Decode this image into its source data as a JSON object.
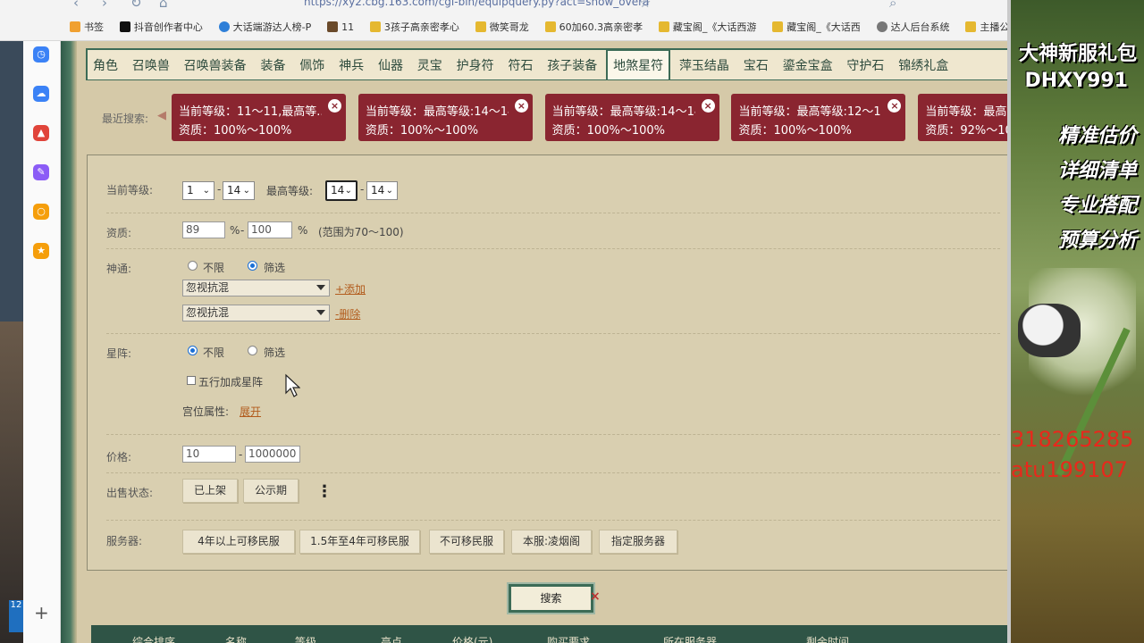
{
  "browser": {
    "url": "https://xy2.cbg.163.com/cgi-bin/equipquery.py?act=show_overa",
    "bookmarks": [
      "书签",
      "抖音创作者中心",
      "大话端游达人榜-P",
      "11",
      "3孩子高亲密孝心",
      "微笑哥龙",
      "60加60.3高亲密孝",
      "藏宝阁_《大话西游",
      "藏宝阁_《大话西",
      "达人后台系统",
      "主播公"
    ]
  },
  "tabs": [
    "角色",
    "召唤兽",
    "召唤兽装备",
    "装备",
    "佩饰",
    "神兵",
    "仙器",
    "灵宝",
    "护身符",
    "符石",
    "孩子装备",
    "地煞星符",
    "萍玉结晶",
    "宝石",
    "鎏金宝盒",
    "守护石",
    "锦绣礼盒"
  ],
  "recent": {
    "label": "最近搜索:",
    "items": [
      {
        "line1": "当前等级：11～11,最高等...",
        "line2": "资质：100%～100%"
      },
      {
        "line1": "当前等级：最高等级:14～14",
        "line2": "资质：100%～100%"
      },
      {
        "line1": "当前等级：最高等级:14～14",
        "line2": "资质：100%～100%"
      },
      {
        "line1": "当前等级：最高等级:12～14",
        "line2": "资质：100%～100%"
      },
      {
        "line1": "当前等级：最高等",
        "line2": "资质：92%～100"
      }
    ]
  },
  "form": {
    "level": {
      "label": "当前等级:",
      "from": "1",
      "to": "14",
      "max_label": "最高等级:",
      "max_from": "14",
      "max_to": "14"
    },
    "quality": {
      "label": "资质:",
      "from": "89",
      "to": "100",
      "pct": "%",
      "range_note": "(范围为70～100)"
    },
    "shentong": {
      "label": "神通:",
      "opt_any": "不限",
      "opt_filter": "筛选",
      "select1": "忽视抗混",
      "select2": "忽视抗混",
      "add": "+添加",
      "remove": "-删除"
    },
    "xingzhen": {
      "label": "星阵:",
      "opt_any": "不限",
      "opt_filter": "筛选",
      "checkbox": "五行加成星阵",
      "palace_label": "宫位属性:",
      "expand": "展开"
    },
    "price": {
      "label": "价格:",
      "from": "10",
      "to": "1000000"
    },
    "sale": {
      "label": "出售状态:",
      "buttons": [
        "已上架",
        "公示期"
      ]
    },
    "server": {
      "label": "服务器:",
      "buttons": [
        "4年以上可移民服",
        "1.5年至4年可移民服",
        "不可移民服",
        "本服:凌烟阁",
        "指定服务器"
      ]
    }
  },
  "search_label": "搜索",
  "result_headers": [
    "综合排序",
    "名称",
    "等级",
    "亮点",
    "价格(元)",
    "购买要求",
    "所在服务器",
    "剩余时间"
  ],
  "overlay": {
    "lines": [
      "大神新服礼包",
      "DHXY991",
      "精准估价",
      "详细清单",
      "专业搭配",
      "预算分析"
    ],
    "numbers": [
      "318265285",
      "atu199107"
    ]
  }
}
